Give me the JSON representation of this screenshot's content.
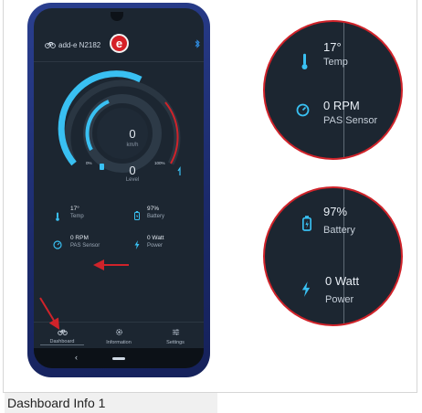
{
  "app": {
    "device_name": "add-e N2182",
    "logo_letter": "e",
    "colors": {
      "accent": "#39c0f2",
      "brand": "#d51f26",
      "background": "#1c2631"
    }
  },
  "gauge": {
    "speed_value": "0",
    "speed_unit": "km/h",
    "level_value": "0",
    "level_label": "Level",
    "left_small_label": "0%",
    "right_small_label": "100%"
  },
  "info": {
    "temp": {
      "value": "17°",
      "label": "Temp",
      "icon": "thermometer-icon"
    },
    "battery": {
      "value": "97%",
      "label": "Battery",
      "icon": "battery-icon"
    },
    "pas": {
      "value": "0 RPM",
      "label": "PAS Sensor",
      "icon": "speedometer-icon"
    },
    "power": {
      "value": "0 Watt",
      "label": "Power",
      "icon": "lightning-icon"
    }
  },
  "nav": {
    "items": [
      {
        "label": "Dashboard",
        "icon": "bike-icon",
        "active": true
      },
      {
        "label": "Information",
        "icon": "gear-info-icon",
        "active": false
      },
      {
        "label": "Settings",
        "icon": "sliders-icon",
        "active": false
      }
    ]
  },
  "zoom_top": {
    "temp_value": "17°",
    "temp_label": "Temp",
    "pas_value": "0 RPM",
    "pas_label": "PAS Sensor"
  },
  "zoom_bottom": {
    "battery_value": "97%",
    "battery_label": "Battery",
    "power_value": "0 Watt",
    "power_label": "Power"
  },
  "caption": "Dashboard Info 1"
}
